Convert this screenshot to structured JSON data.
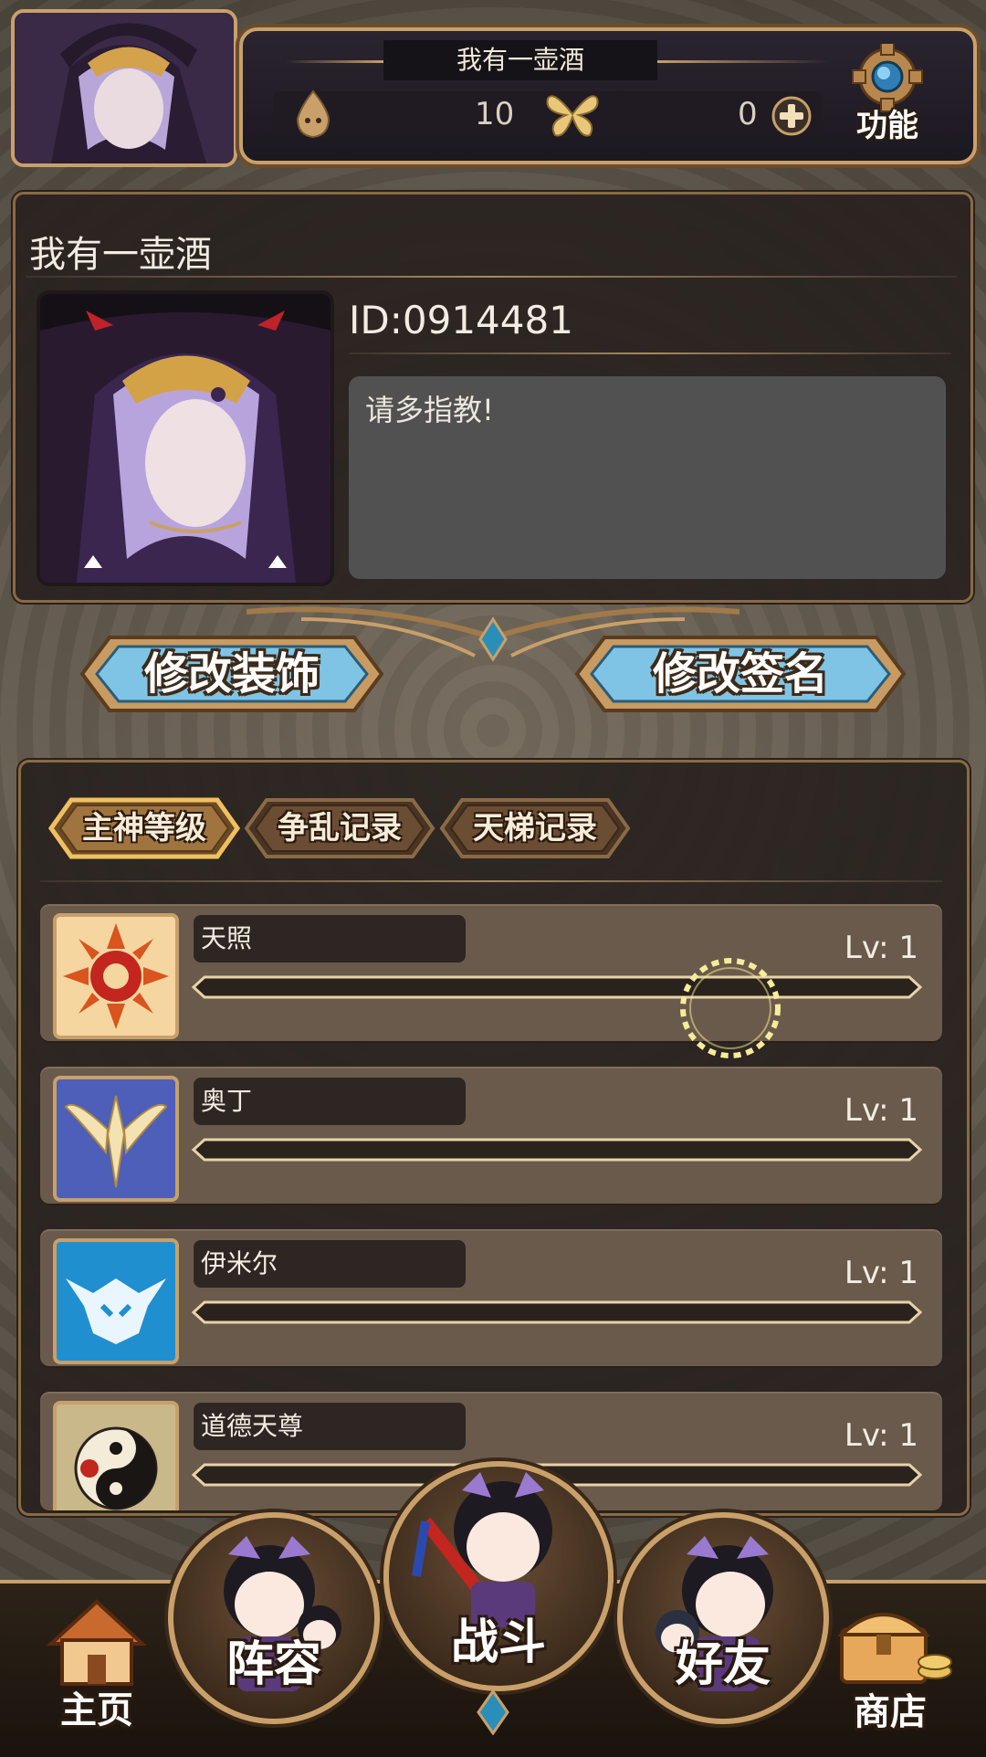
{
  "header": {
    "player_name": "我有一壶酒",
    "soul_count": "10",
    "butterfly_count": "0",
    "settings_label": "功能"
  },
  "profile": {
    "name": "我有一壶酒",
    "id_text": "ID:0914481",
    "signature": "请多指教!"
  },
  "actions": {
    "edit_decor_label": "修改装饰",
    "edit_signature_label": "修改签名"
  },
  "tabs": [
    {
      "label": "主神等级",
      "active": true
    },
    {
      "label": "争乱记录",
      "active": false
    },
    {
      "label": "天梯记录",
      "active": false
    }
  ],
  "gods": [
    {
      "name": "天照",
      "level": "Lv: 1",
      "icon": "sun-crest-icon",
      "progress": 0
    },
    {
      "name": "奥丁",
      "level": "Lv: 1",
      "icon": "wing-spear-icon",
      "progress": 0
    },
    {
      "name": "伊米尔",
      "level": "Lv: 1",
      "icon": "frost-skull-icon",
      "progress": 0
    },
    {
      "name": "道德天尊",
      "level": "Lv: 1",
      "icon": "yin-yang-icon",
      "progress": 0
    }
  ],
  "nav": {
    "home": "主页",
    "lineup": "阵容",
    "battle": "战斗",
    "friends": "好友",
    "shop": "商店"
  },
  "colors": {
    "gold_frame": "#c9a06a",
    "button_blue": "#7fc4e4",
    "panel_dark": "#28221e"
  }
}
